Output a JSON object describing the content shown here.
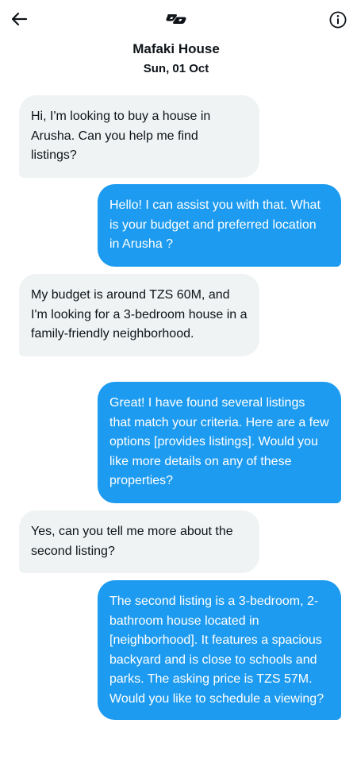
{
  "header": {
    "back_icon": "arrow-left-icon",
    "logo_icon": "brand-logo-icon",
    "info_icon": "info-circle-icon",
    "title": "Mafaki House",
    "date": "Sun, 01 Oct"
  },
  "colors": {
    "outgoing_bubble": "#1d9bf0",
    "incoming_bubble": "#eff3f4",
    "text": "#0f1419"
  },
  "messages": [
    {
      "direction": "incoming",
      "text": "Hi, I'm looking to buy a house in Arusha. Can you help me find listings?"
    },
    {
      "direction": "outgoing",
      "text": "Hello! I can assist you with that. What is your budget and preferred location in Arusha ?"
    },
    {
      "direction": "incoming",
      "text": "My budget is around TZS 60M, and I'm looking for a 3-bedroom house in a family-friendly neighborhood."
    },
    {
      "direction": "outgoing",
      "text": "Great! I have found several listings that match your criteria. Here are a few options [provides listings]. Would you like more details on any of these properties?"
    },
    {
      "direction": "incoming",
      "text": "Yes, can you tell me more about the second listing?"
    },
    {
      "direction": "outgoing",
      "text": " The second listing is a 3-bedroom, 2-bathroom house located in [neighborhood]. It features a spacious backyard and is close to schools and parks. The asking price is TZS 57M. Would you like to schedule a viewing?"
    }
  ]
}
